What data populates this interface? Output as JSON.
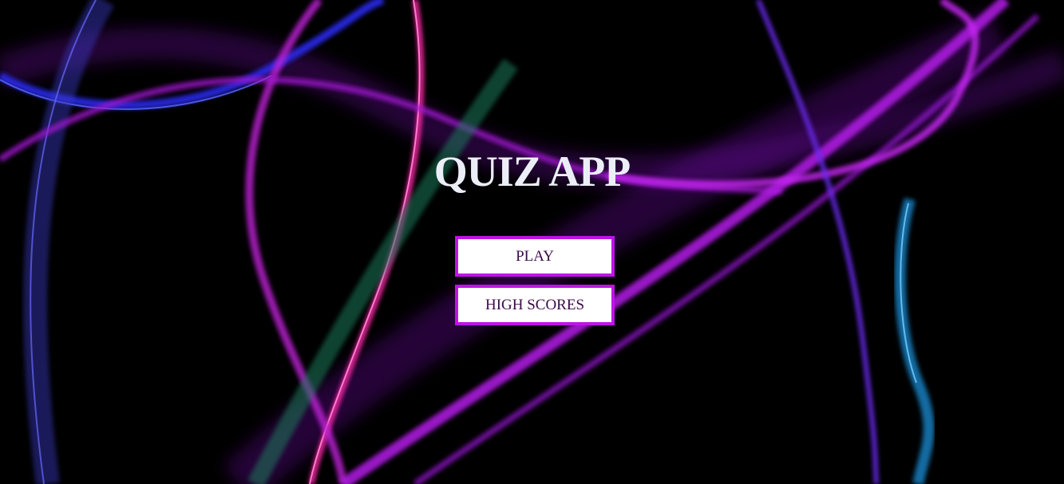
{
  "app": {
    "title": "QUIZ APP"
  },
  "menu": {
    "play_label": "PLAY",
    "high_scores_label": "HIGH SCORES"
  },
  "colors": {
    "background": "#000000",
    "title": "#eceef7",
    "button_border": "#bf14e6",
    "button_bg": "#ffffff",
    "button_text": "#3b0a4a"
  }
}
